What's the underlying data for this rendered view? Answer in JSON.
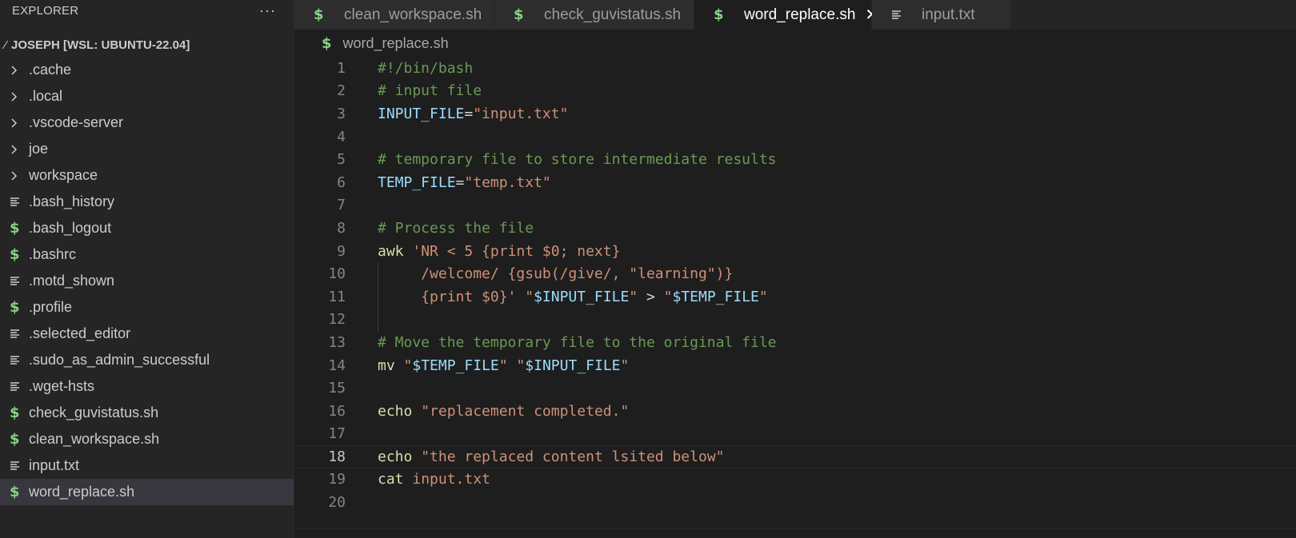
{
  "explorer": {
    "title": "EXPLORER",
    "more": "···",
    "root_label": "JOSEPH [WSL: UBUNTU-22.04]",
    "items": [
      {
        "label": ".cache",
        "icon": "chevron-right-icon"
      },
      {
        "label": ".local",
        "icon": "chevron-right-icon"
      },
      {
        "label": ".vscode-server",
        "icon": "chevron-right-icon"
      },
      {
        "label": "joe",
        "icon": "chevron-right-icon"
      },
      {
        "label": "workspace",
        "icon": "chevron-right-icon"
      },
      {
        "label": ".bash_history",
        "icon": "text-file-icon"
      },
      {
        "label": ".bash_logout",
        "icon": "shell-file-icon"
      },
      {
        "label": ".bashrc",
        "icon": "shell-file-icon"
      },
      {
        "label": ".motd_shown",
        "icon": "text-file-icon"
      },
      {
        "label": ".profile",
        "icon": "shell-file-icon"
      },
      {
        "label": ".selected_editor",
        "icon": "text-file-icon"
      },
      {
        "label": ".sudo_as_admin_successful",
        "icon": "text-file-icon"
      },
      {
        "label": ".wget-hsts",
        "icon": "text-file-icon"
      },
      {
        "label": "check_guvistatus.sh",
        "icon": "shell-file-icon"
      },
      {
        "label": "clean_workspace.sh",
        "icon": "shell-file-icon"
      },
      {
        "label": "input.txt",
        "icon": "text-file-icon"
      },
      {
        "label": "word_replace.sh",
        "icon": "shell-file-icon",
        "selected": true
      }
    ]
  },
  "tabs": [
    {
      "label": "clean_workspace.sh",
      "icon": "shell-file-icon"
    },
    {
      "label": "check_guvistatus.sh",
      "icon": "shell-file-icon"
    },
    {
      "label": "word_replace.sh",
      "icon": "shell-file-icon",
      "active": true,
      "close": "✕"
    },
    {
      "label": "input.txt",
      "icon": "text-file-icon"
    }
  ],
  "breadcrumb": {
    "file": "word_replace.sh"
  },
  "editor": {
    "active_line": 18,
    "lines": [
      {
        "n": "1",
        "tokens": [
          {
            "t": "#!/bin/bash",
            "c": "comment"
          }
        ]
      },
      {
        "n": "2",
        "tokens": [
          {
            "t": "# input file",
            "c": "comment"
          }
        ]
      },
      {
        "n": "3",
        "tokens": [
          {
            "t": "INPUT_FILE",
            "c": "var"
          },
          {
            "t": "=",
            "c": "plain"
          },
          {
            "t": "\"input.txt\"",
            "c": "str"
          }
        ]
      },
      {
        "n": "4",
        "tokens": []
      },
      {
        "n": "5",
        "tokens": [
          {
            "t": "# temporary file to store intermediate results",
            "c": "comment"
          }
        ]
      },
      {
        "n": "6",
        "tokens": [
          {
            "t": "TEMP_FILE",
            "c": "var"
          },
          {
            "t": "=",
            "c": "plain"
          },
          {
            "t": "\"temp.txt\"",
            "c": "str"
          }
        ]
      },
      {
        "n": "7",
        "tokens": []
      },
      {
        "n": "8",
        "tokens": [
          {
            "t": "# Process the file",
            "c": "comment"
          }
        ]
      },
      {
        "n": "9",
        "tokens": [
          {
            "t": "awk",
            "c": "cmd"
          },
          {
            "t": " ",
            "c": "plain"
          },
          {
            "t": "'NR < 5 {print $0; next}",
            "c": "str"
          }
        ]
      },
      {
        "n": "10",
        "guide": true,
        "tokens": [
          {
            "t": "     /welcome/ {gsub(/give/, \"learning\")}",
            "c": "str"
          }
        ]
      },
      {
        "n": "11",
        "guide": true,
        "tokens": [
          {
            "t": "     {print $0}'",
            "c": "str"
          },
          {
            "t": " ",
            "c": "plain"
          },
          {
            "t": "\"",
            "c": "str"
          },
          {
            "t": "$INPUT_FILE",
            "c": "var"
          },
          {
            "t": "\"",
            "c": "str"
          },
          {
            "t": " > ",
            "c": "plain"
          },
          {
            "t": "\"",
            "c": "str"
          },
          {
            "t": "$TEMP_FILE",
            "c": "var"
          },
          {
            "t": "\"",
            "c": "str"
          }
        ]
      },
      {
        "n": "12",
        "guide": true,
        "tokens": []
      },
      {
        "n": "13",
        "tokens": [
          {
            "t": "# Move the temporary file to the original file",
            "c": "comment"
          }
        ]
      },
      {
        "n": "14",
        "tokens": [
          {
            "t": "mv",
            "c": "cmd"
          },
          {
            "t": " ",
            "c": "plain"
          },
          {
            "t": "\"",
            "c": "str"
          },
          {
            "t": "$TEMP_FILE",
            "c": "var"
          },
          {
            "t": "\"",
            "c": "str"
          },
          {
            "t": " ",
            "c": "plain"
          },
          {
            "t": "\"",
            "c": "str"
          },
          {
            "t": "$INPUT_FILE",
            "c": "var"
          },
          {
            "t": "\"",
            "c": "str"
          }
        ]
      },
      {
        "n": "15",
        "tokens": []
      },
      {
        "n": "16",
        "tokens": [
          {
            "t": "echo",
            "c": "cmd"
          },
          {
            "t": " ",
            "c": "plain"
          },
          {
            "t": "\"replacement completed.\"",
            "c": "str"
          }
        ]
      },
      {
        "n": "17",
        "tokens": []
      },
      {
        "n": "18",
        "tokens": [
          {
            "t": "echo",
            "c": "cmd"
          },
          {
            "t": " ",
            "c": "plain"
          },
          {
            "t": "\"the replaced content lsited below\"",
            "c": "str"
          }
        ]
      },
      {
        "n": "19",
        "tokens": [
          {
            "t": "cat",
            "c": "cmd"
          },
          {
            "t": " ",
            "c": "plain"
          },
          {
            "t": "input.txt",
            "c": "str"
          }
        ]
      },
      {
        "n": "20",
        "tokens": []
      }
    ]
  },
  "colors": {
    "comment": "#6a9955",
    "var": "#9cdcfe",
    "str": "#ce9178",
    "cmd": "#dcdcaa",
    "shell_icon": "#89d185"
  }
}
